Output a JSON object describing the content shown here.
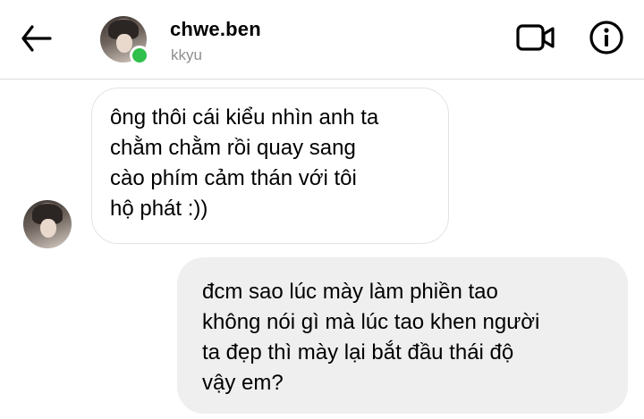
{
  "header": {
    "username": "chwe.ben",
    "subname": "kkyu"
  },
  "icons": {
    "back": "arrow-left-icon",
    "video": "video-camera-icon",
    "info": "info-icon"
  },
  "colors": {
    "online": "#2fbf4a",
    "outgoing_bubble": "#efefef",
    "subtext": "#8e8e8e"
  },
  "messages": [
    {
      "direction": "incoming",
      "lines": [
        "ông thôi cái kiểu nhìn anh ta",
        "chằm chằm rồi quay sang",
        "cào phím cảm thán với tôi",
        "hộ phát  :))"
      ]
    },
    {
      "direction": "outgoing",
      "lines": [
        "đcm sao lúc mày làm phiền tao",
        "không nói gì mà lúc tao khen người",
        "ta đẹp thì mày lại bắt đầu thái độ",
        "vậy em?"
      ]
    }
  ]
}
